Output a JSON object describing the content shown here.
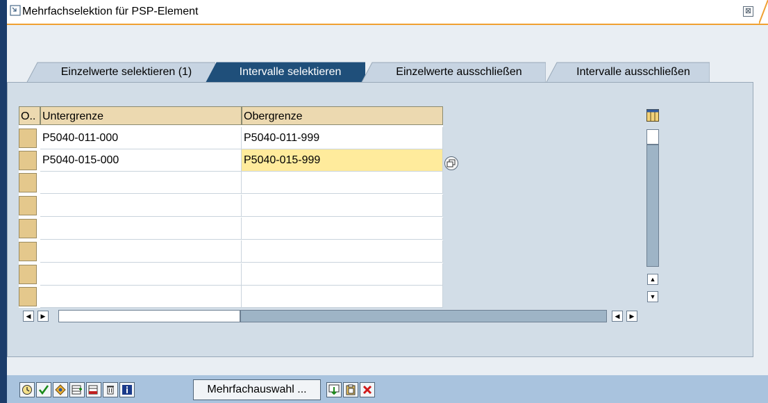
{
  "window": {
    "title": "Mehrfachselektion für PSP-Element",
    "close_glyph": "⊠"
  },
  "tabs": [
    {
      "label": "Einzelwerte selektieren (1)",
      "active": false
    },
    {
      "label": "Intervalle selektieren",
      "active": true
    },
    {
      "label": "Einzelwerte ausschließen",
      "active": false
    },
    {
      "label": "Intervalle ausschließen",
      "active": false
    }
  ],
  "table": {
    "columns": [
      "O..",
      "Untergrenze",
      "Obergrenze"
    ],
    "rows": [
      {
        "lower": "P5040-011-000",
        "upper": "P5040-011-999"
      },
      {
        "lower": "P5040-015-000",
        "upper": "P5040-015-999"
      },
      {
        "lower": "",
        "upper": ""
      },
      {
        "lower": "",
        "upper": ""
      },
      {
        "lower": "",
        "upper": ""
      },
      {
        "lower": "",
        "upper": ""
      },
      {
        "lower": "",
        "upper": ""
      },
      {
        "lower": "",
        "upper": ""
      }
    ]
  },
  "footer": {
    "multi_select_label": "Mehrfachauswahl ...",
    "icons": [
      "clock-icon",
      "check-icon",
      "transfer-icon",
      "insert-row-icon",
      "delete-row-icon",
      "trash-icon",
      "info-icon",
      "import-icon",
      "clipboard-icon",
      "cancel-icon"
    ]
  },
  "colors": {
    "accent": "#f0a030",
    "active_tab": "#1f4f7a",
    "tab_inactive": "#c7d4e2",
    "header_cell": "#ecd9b0",
    "highlight_cell": "#ffeb9c",
    "footer_bar": "#a9c3de"
  }
}
